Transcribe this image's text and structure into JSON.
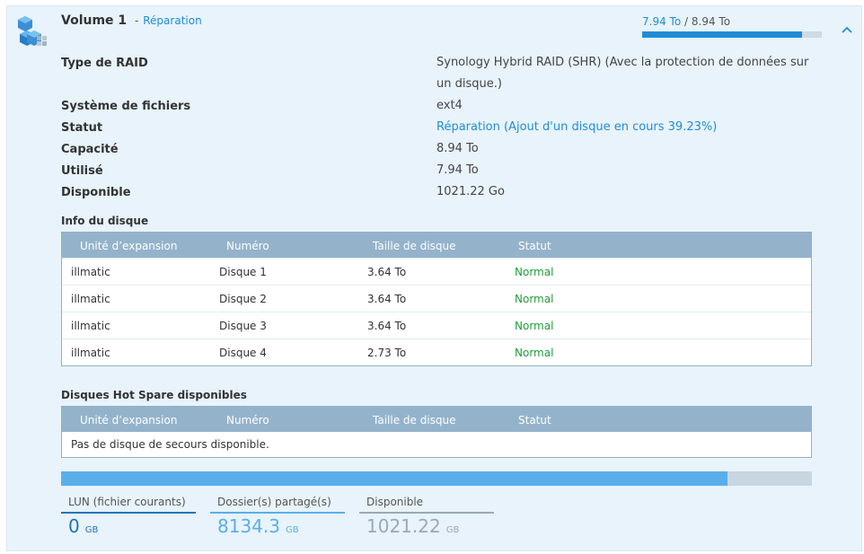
{
  "volume": {
    "title": "Volume 1",
    "separator": "-",
    "state": "Réparation",
    "usage_used": "7.94 To",
    "usage_slash": "/",
    "usage_total": "8.94 To",
    "usage_fraction": 0.888,
    "icon": "volume-cubes-icon",
    "collapse_icon": "chevron-up-icon"
  },
  "properties": [
    {
      "label": "Type de RAID",
      "value": "Synology Hybrid RAID (SHR) (Avec la protection de données sur un disque.)"
    },
    {
      "label": "Système de fichiers",
      "value": "ext4"
    },
    {
      "label": "Statut",
      "value": "Réparation (Ajout d'un disque en cours 39.23%)"
    },
    {
      "label": "Capacité",
      "value": "8.94 To"
    },
    {
      "label": "Utilisé",
      "value": "7.94 To"
    },
    {
      "label": "Disponible",
      "value": "1021.22 Go"
    }
  ],
  "disk_info": {
    "title": "Info du disque",
    "columns": [
      "Unité d’expansion",
      "Numéro",
      "Taille de disque",
      "Statut"
    ],
    "rows": [
      {
        "unit": "illmatic",
        "number": "Disque 1",
        "size": "3.64 To",
        "status": "Normal"
      },
      {
        "unit": "illmatic",
        "number": "Disque 2",
        "size": "3.64 To",
        "status": "Normal"
      },
      {
        "unit": "illmatic",
        "number": "Disque 3",
        "size": "3.64 To",
        "status": "Normal"
      },
      {
        "unit": "illmatic",
        "number": "Disque 4",
        "size": "2.73 To",
        "status": "Normal"
      }
    ]
  },
  "hot_spare": {
    "title": "Disques Hot Spare disponibles",
    "columns": [
      "Unité d’expansion",
      "Numéro",
      "Taille de disque",
      "Statut"
    ],
    "empty_text": "Pas de disque de secours disponible."
  },
  "capacity_bar": {
    "used_fraction": 0.888,
    "legend": [
      {
        "label": "LUN (fichier courants)",
        "value": "0",
        "unit": "GB",
        "color": "#1a75bc"
      },
      {
        "label": "Dossier(s) partagé(s)",
        "value": "8134.3",
        "unit": "GB",
        "color": "#5aaeea"
      },
      {
        "label": "Disponible",
        "value": "1021.22",
        "unit": "GB",
        "color": "#9aa9b5"
      }
    ]
  },
  "colors": {
    "accent": "#1f8dd6",
    "ok": "#1f9d3a",
    "panel_bg": "#e8f3fb",
    "grid_header": "#94b3cb"
  }
}
